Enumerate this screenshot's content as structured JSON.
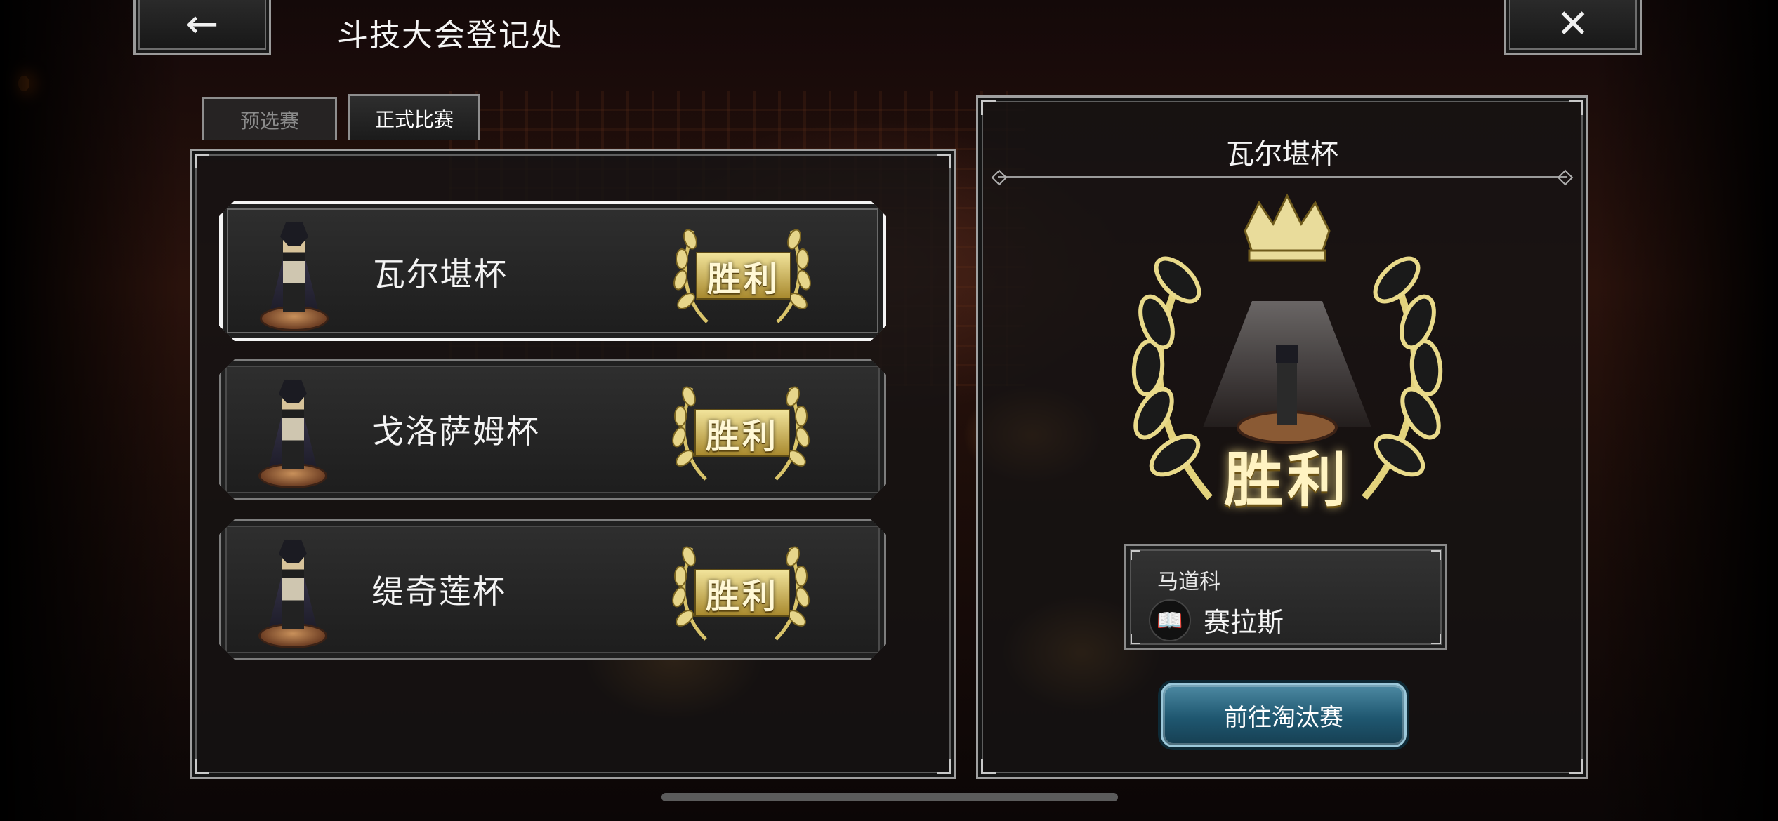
{
  "header": {
    "title": "斗技大会登记处",
    "back_label": "←",
    "close_label": "✕"
  },
  "tabs": [
    {
      "label": "预选赛",
      "active": false
    },
    {
      "label": "正式比赛",
      "active": true
    }
  ],
  "cups": [
    {
      "name": "瓦尔堪杯",
      "result": "胜利",
      "selected": true
    },
    {
      "name": "戈洛萨姆杯",
      "result": "胜利",
      "selected": false
    },
    {
      "name": "缇奇莲杯",
      "result": "胜利",
      "selected": false
    }
  ],
  "detail": {
    "title": "瓦尔堪杯",
    "badge_text": "胜利",
    "champion_region": "马道科",
    "champion_icon": "book-icon",
    "champion_name": "赛拉斯",
    "action_label": "前往淘汰赛"
  },
  "colors": {
    "gold": "#d8c36a",
    "button_blue": "#2a6a86",
    "frame_gray": "#a0a0a0"
  }
}
